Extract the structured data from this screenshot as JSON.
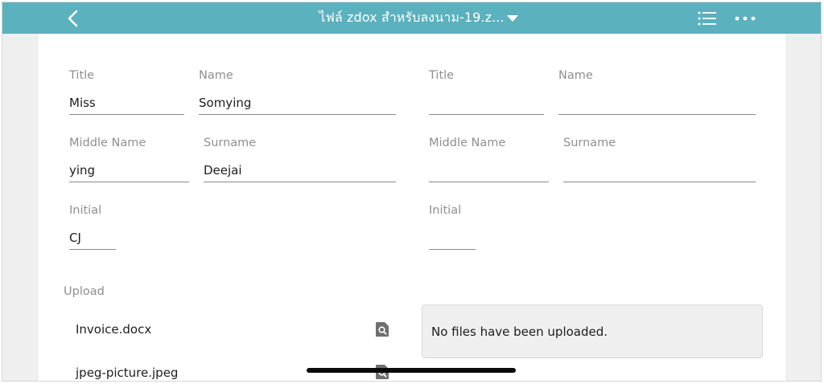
{
  "topbar": {
    "document_title": "ไฟล์ zdox สำหรับลงนาม-19.z...",
    "icons": [
      "chevron-left-icon",
      "caret-down-icon",
      "list-icon",
      "more-horizontal-icon"
    ],
    "color": "#5bb1bd"
  },
  "left_signer": {
    "title_label": "Title",
    "title_value": "Miss",
    "name_label": "Name",
    "name_value": "Somying",
    "middle_name_label": "Middle Name",
    "middle_name_value": "ying",
    "surname_label": "Surname",
    "surname_value": "Deejai",
    "initial_label": "Initial",
    "initial_value": "CJ"
  },
  "right_signer": {
    "title_label": "Title",
    "title_value": "",
    "name_label": "Name",
    "name_value": "",
    "middle_name_label": "Middle Name",
    "middle_name_value": "",
    "surname_label": "Surname",
    "surname_value": "",
    "initial_label": "Initial",
    "initial_value": ""
  },
  "upload": {
    "label": "Upload",
    "files": [
      {
        "name": "Invoice.docx",
        "icon": "file-search-icon"
      },
      {
        "name": "jpeg-picture.jpeg",
        "icon": "file-search-icon"
      }
    ],
    "empty_message": "No files have been uploaded."
  }
}
